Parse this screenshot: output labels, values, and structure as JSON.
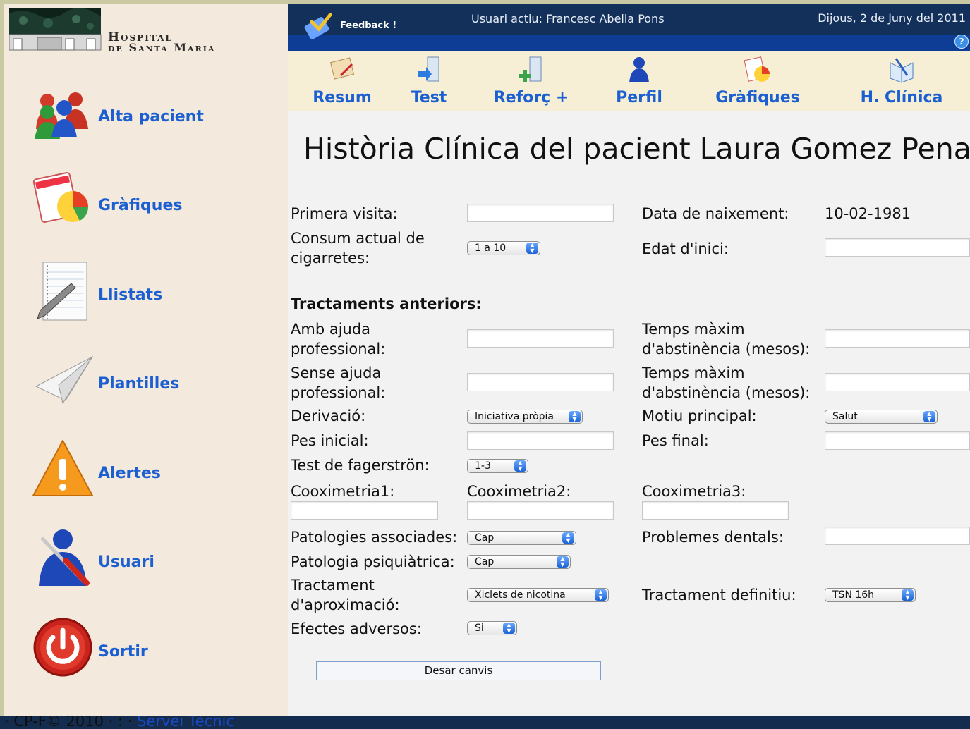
{
  "logo": {
    "line1": "Hospital",
    "line2": "de Santa Maria"
  },
  "sidebar": {
    "items": [
      {
        "label": "Alta pacient",
        "icon": "add-patient-icon"
      },
      {
        "label": "Gràfiques",
        "icon": "charts-icon"
      },
      {
        "label": "Llistats",
        "icon": "list-notepad-icon"
      },
      {
        "label": "Plantilles",
        "icon": "paper-plane-icon"
      },
      {
        "label": "Alertes",
        "icon": "warning-icon"
      },
      {
        "label": "Usuari",
        "icon": "user-tools-icon"
      },
      {
        "label": "Sortir",
        "icon": "power-icon"
      }
    ]
  },
  "header": {
    "feedback_label": "Feedback !",
    "active_user": "Usuari actiu: Francesc Abella Pons",
    "date": "Dijous, 2 de Juny del 2011",
    "help_icon": "help-icon"
  },
  "tabs": [
    {
      "label": "Resum",
      "icon": "summary-icon"
    },
    {
      "label": "Test",
      "icon": "test-icon"
    },
    {
      "label": "Reforç +",
      "icon": "reinforce-icon"
    },
    {
      "label": "Perfil",
      "icon": "profile-icon"
    },
    {
      "label": "Gràfiques",
      "icon": "charts-icon"
    },
    {
      "label": "H. Clínica",
      "icon": "clinical-history-icon"
    }
  ],
  "form": {
    "title": "Història Clínica del pacient Laura Gomez Pena",
    "primera_visita_label": "Primera visita:",
    "primera_visita_value": "",
    "data_naixement_label": "Data de naixement:",
    "data_naixement_value": "10-02-1981",
    "consum_label_1": "Consum actual de",
    "consum_label_2": "cigarretes:",
    "consum_value": "1 a 10",
    "edat_inici_label": "Edat d'inici:",
    "edat_inici_value": "",
    "section_tractaments": "Tractaments anteriors:",
    "amb_ajuda_label_1": "Amb ajuda",
    "amb_ajuda_label_2": "professional:",
    "temps_maxim_label_1": "Temps màxim",
    "temps_maxim_label_2": "d'abstinència (mesos):",
    "sense_ajuda_label_1": "Sense ajuda",
    "sense_ajuda_label_2": "professional:",
    "derivacio_label": "Derivació:",
    "derivacio_value": "Iniciativa pròpia",
    "motiu_label": "Motiu principal:",
    "motiu_value": "Salut",
    "pes_inicial_label": "Pes inicial:",
    "pes_final_label": "Pes final:",
    "fagerstrom_label": "Test de fagerströn:",
    "fagerstrom_value": "1-3",
    "cooximetria1_label": "Cooximetria1:",
    "cooximetria2_label": "Cooximetria2:",
    "cooximetria3_label": "Cooximetria3:",
    "patologies_label": "Patologies associades:",
    "patologies_value": "Cap",
    "problemes_dentals_label": "Problemes dentals:",
    "psiquiatrica_label": "Patologia psiquiàtrica:",
    "psiquiatrica_value": "Cap",
    "tract_aprox_label_1": "Tractament",
    "tract_aprox_label_2": "d'aproximació:",
    "tract_aprox_value": "Xiclets de nicotina",
    "tract_def_label": "Tractament definitiu:",
    "tract_def_value": "TSN 16h",
    "efectes_label": "Efectes adversos:",
    "efectes_value": "Si",
    "save_label": "Desar canvis"
  },
  "footer": {
    "text": "· CP-F© 2010 · : · ",
    "link": "Servei Tècnic"
  },
  "colors": {
    "accent_blue": "#1b5fd1",
    "header_navy": "#12305a",
    "sidebar_bg": "#f4e9dd",
    "tab_bg": "#f6efd6"
  }
}
